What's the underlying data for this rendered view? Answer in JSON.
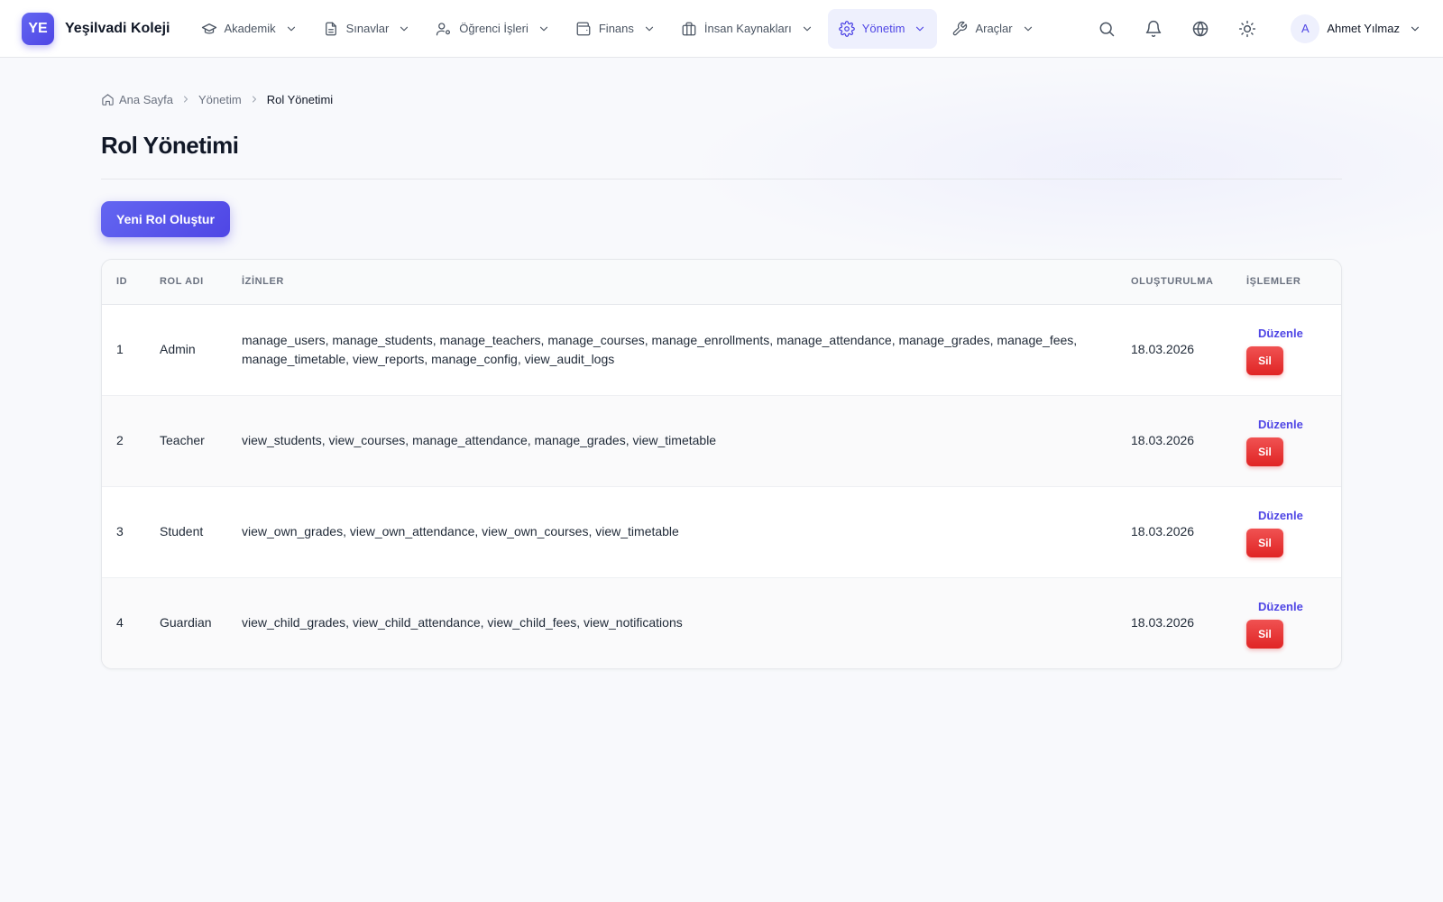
{
  "brand": {
    "logo_text": "YE",
    "name": "Yeşilvadi Koleji",
    "accent_color": "#4f46e5"
  },
  "nav": {
    "items": [
      {
        "label": "Akademik",
        "icon": "graduation-cap-icon"
      },
      {
        "label": "Sınavlar",
        "icon": "document-icon"
      },
      {
        "label": "Öğrenci İşleri",
        "icon": "user-gear-icon"
      },
      {
        "label": "Finans",
        "icon": "wallet-icon"
      },
      {
        "label": "İnsan Kaynakları",
        "icon": "briefcase-icon"
      },
      {
        "label": "Yönetim",
        "icon": "gear-icon",
        "active": true
      },
      {
        "label": "Araçlar",
        "icon": "wrench-icon"
      }
    ]
  },
  "header_actions": [
    "search-icon",
    "bell-icon",
    "globe-icon",
    "sun-icon"
  ],
  "user": {
    "initial": "A",
    "name": "Ahmet Yılmaz"
  },
  "breadcrumb": {
    "home": "Ana Sayfa",
    "section": "Yönetim",
    "current": "Rol Yönetimi"
  },
  "page": {
    "title": "Rol Yönetimi",
    "create_button": "Yeni Rol Oluştur"
  },
  "table": {
    "headers": {
      "id": "ID",
      "name": "ROL ADI",
      "permissions": "İZİNLER",
      "created": "OLUŞTURULMA",
      "actions": "İŞLEMLER"
    },
    "edit_label": "Düzenle",
    "delete_label": "Sil",
    "rows": [
      {
        "id": "1",
        "name": "Admin",
        "permissions": "manage_users, manage_students, manage_teachers, manage_courses, manage_enrollments, manage_attendance, manage_grades, manage_fees, manage_timetable, view_reports, manage_config, view_audit_logs",
        "created": "18.03.2026"
      },
      {
        "id": "2",
        "name": "Teacher",
        "permissions": "view_students, view_courses, manage_attendance, manage_grades, view_timetable",
        "created": "18.03.2026"
      },
      {
        "id": "3",
        "name": "Student",
        "permissions": "view_own_grades, view_own_attendance, view_own_courses, view_timetable",
        "created": "18.03.2026"
      },
      {
        "id": "4",
        "name": "Guardian",
        "permissions": "view_child_grades, view_child_attendance, view_child_fees, view_notifications",
        "created": "18.03.2026"
      }
    ]
  }
}
